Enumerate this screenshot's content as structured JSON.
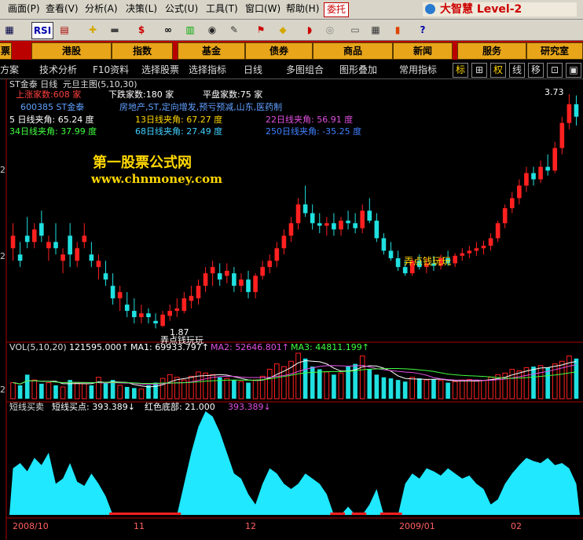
{
  "menu": [
    "画面(P)",
    "查看(V)",
    "分析(A)",
    "决策(L)",
    "公式(U)",
    "工具(T)",
    "窗口(W)",
    "帮助(H)"
  ],
  "entrust_label": "委托",
  "brand": "大智慧 Level-2",
  "toolbar_icons": [
    "grid-icon",
    "rsi-icon",
    "chart-icon",
    "cross-icon",
    "ruler-icon",
    "dollar-icon",
    "glasses-icon",
    "analysis-icon",
    "binoculars-icon",
    "tools-icon",
    "flag-icon",
    "diamond-icon",
    "lips-icon",
    "cd-icon",
    "print-icon",
    "table-icon",
    "bars-icon",
    "help-icon"
  ],
  "toolbar_text": {
    "rsi": "RSI",
    "dollar": "$"
  },
  "tabs": [
    "票",
    "港股",
    "指数",
    "基金",
    "债券",
    "商品",
    "新闻",
    "服务",
    "研究室"
  ],
  "subbar": [
    "方案",
    "技术分析",
    "F10资料",
    "选择股票",
    "选择指标",
    "日线",
    "多图组合",
    "图形叠加",
    "常用指标"
  ],
  "subbar_buttons": [
    "标",
    "⊞",
    "权",
    "线",
    "移",
    "⊡",
    "▣"
  ],
  "chart_header": {
    "title": "ST金泰 日线",
    "subtitle": "元旦主图(5,10,30)",
    "up_count": "上涨家数:608 家",
    "down_count": "下跌家数:180 家",
    "flat_count": "平盘家数:75 家",
    "stock_code": "600385 ST金泰",
    "tags": "房地产,ST,定向增发,预亏预减,山东,医药制",
    "angles": [
      {
        "label": "5 日线夹角: 65.24 度",
        "color": "#ffffff"
      },
      {
        "label": "13日线夹角: 67.27 度",
        "color": "#ffd700"
      },
      {
        "label": "22日线夹角: 56.91 度",
        "color": "#e050e0"
      },
      {
        "label": "34日线夹角: 37.99 度",
        "color": "#40ff40"
      },
      {
        "label": "68日线夹角: 27.49 度",
        "color": "#40d0ff"
      },
      {
        "label": "250日线夹角: -35.25 度",
        "color": "#4080ff"
      }
    ],
    "high_label": "3.73",
    "low_label": "1.87",
    "low_note": "弄点钱玩玩",
    "mid_note": "弄点钱玩玩"
  },
  "watermark": {
    "line1": "第一股票公式网",
    "line2": "www.chnmoney.com"
  },
  "volume_header": {
    "name": "VOL(5,10,20)",
    "vol": "121595.000↑",
    "ma1": "MA1: 69933.797↑",
    "ma2": "MA2: 52646.801↑",
    "ma3": "MA3: 44811.199↑"
  },
  "indicator_header": {
    "name": "短线买卖",
    "buy": "短线买点: 393.389↓",
    "red": "红色底部: 21.000",
    "val": "393.389↓"
  },
  "x_axis": [
    "2008/10",
    "11",
    "12",
    "2009/01",
    "02"
  ],
  "left_edge_ticks": [
    "2",
    "2",
    "2"
  ],
  "chart_data": [
    {
      "type": "candlestick",
      "title": "ST金泰 日线",
      "up_color": "#ff2020",
      "down_color": "#20e0e0",
      "candles": [
        [
          2.5,
          2.7,
          2.4,
          2.6
        ],
        [
          2.45,
          2.55,
          2.35,
          2.4
        ],
        [
          2.6,
          2.75,
          2.5,
          2.55
        ],
        [
          2.55,
          2.7,
          2.5,
          2.65
        ],
        [
          2.7,
          2.8,
          2.55,
          2.6
        ],
        [
          2.5,
          2.6,
          2.4,
          2.55
        ],
        [
          2.55,
          2.7,
          2.45,
          2.5
        ],
        [
          2.4,
          2.5,
          2.3,
          2.45
        ],
        [
          2.6,
          2.7,
          2.35,
          2.45
        ],
        [
          2.4,
          2.55,
          2.35,
          2.5
        ],
        [
          2.55,
          2.7,
          2.5,
          2.6
        ],
        [
          2.45,
          2.55,
          2.35,
          2.4
        ],
        [
          2.35,
          2.45,
          2.25,
          2.4
        ],
        [
          2.3,
          2.4,
          2.2,
          2.25
        ],
        [
          2.2,
          2.3,
          2.05,
          2.1
        ],
        [
          2.1,
          2.2,
          2.0,
          2.15
        ],
        [
          2.05,
          2.15,
          1.95,
          2.0
        ],
        [
          2.0,
          2.1,
          1.9,
          1.95
        ],
        [
          1.95,
          2.05,
          1.9,
          1.98
        ],
        [
          1.98,
          2.02,
          1.9,
          1.95
        ],
        [
          1.92,
          1.98,
          1.86,
          1.9
        ],
        [
          1.88,
          2.0,
          1.87,
          1.97
        ],
        [
          1.96,
          2.05,
          1.92,
          2.0
        ],
        [
          2.0,
          2.1,
          1.95,
          2.02
        ],
        [
          2.0,
          2.15,
          1.98,
          2.1
        ],
        [
          2.08,
          2.2,
          2.02,
          2.12
        ],
        [
          2.1,
          2.25,
          2.05,
          2.2
        ],
        [
          2.2,
          2.35,
          2.15,
          2.3
        ],
        [
          2.3,
          2.4,
          2.2,
          2.35
        ],
        [
          2.3,
          2.38,
          2.2,
          2.25
        ],
        [
          2.28,
          2.38,
          2.22,
          2.32
        ],
        [
          2.3,
          2.35,
          2.15,
          2.2
        ],
        [
          2.2,
          2.3,
          2.15,
          2.25
        ],
        [
          2.25,
          2.32,
          2.1,
          2.15
        ],
        [
          2.15,
          2.3,
          2.1,
          2.28
        ],
        [
          2.28,
          2.4,
          2.25,
          2.35
        ],
        [
          2.35,
          2.45,
          2.3,
          2.4
        ],
        [
          2.4,
          2.55,
          2.35,
          2.5
        ],
        [
          2.5,
          2.65,
          2.45,
          2.6
        ],
        [
          2.6,
          2.75,
          2.55,
          2.7
        ],
        [
          2.7,
          2.9,
          2.65,
          2.85
        ],
        [
          2.85,
          3.0,
          2.75,
          2.78
        ],
        [
          2.78,
          2.85,
          2.65,
          2.7
        ],
        [
          2.7,
          2.78,
          2.62,
          2.68
        ],
        [
          2.68,
          2.75,
          2.6,
          2.7
        ],
        [
          2.7,
          2.78,
          2.6,
          2.65
        ],
        [
          2.65,
          2.75,
          2.6,
          2.72
        ],
        [
          2.72,
          2.8,
          2.65,
          2.7
        ],
        [
          2.7,
          2.78,
          2.62,
          2.66
        ],
        [
          2.66,
          2.85,
          2.62,
          2.8
        ],
        [
          2.8,
          2.9,
          2.7,
          2.72
        ],
        [
          2.72,
          2.78,
          2.55,
          2.58
        ],
        [
          2.58,
          2.62,
          2.45,
          2.48
        ],
        [
          2.48,
          2.55,
          2.4,
          2.42
        ],
        [
          2.42,
          2.48,
          2.32,
          2.35
        ],
        [
          2.35,
          2.4,
          2.28,
          2.3
        ],
        [
          2.3,
          2.42,
          2.28,
          2.4
        ],
        [
          2.4,
          2.45,
          2.33,
          2.35
        ],
        [
          2.35,
          2.42,
          2.3,
          2.38
        ],
        [
          2.38,
          2.44,
          2.32,
          2.36
        ],
        [
          2.36,
          2.45,
          2.33,
          2.42
        ],
        [
          2.42,
          2.48,
          2.36,
          2.38
        ],
        [
          2.38,
          2.46,
          2.35,
          2.44
        ],
        [
          2.44,
          2.5,
          2.4,
          2.46
        ],
        [
          2.46,
          2.52,
          2.42,
          2.48
        ],
        [
          2.48,
          2.55,
          2.44,
          2.5
        ],
        [
          2.5,
          2.56,
          2.45,
          2.52
        ],
        [
          2.52,
          2.62,
          2.48,
          2.58
        ],
        [
          2.58,
          2.72,
          2.55,
          2.7
        ],
        [
          2.7,
          2.85,
          2.66,
          2.82
        ],
        [
          2.82,
          2.95,
          2.78,
          2.9
        ],
        [
          2.9,
          3.05,
          2.85,
          3.0
        ],
        [
          3.0,
          3.15,
          2.95,
          3.1
        ],
        [
          3.1,
          3.15,
          3.0,
          3.05
        ],
        [
          3.05,
          3.2,
          3.02,
          3.15
        ],
        [
          3.15,
          3.25,
          3.08,
          3.12
        ],
        [
          3.12,
          3.35,
          3.1,
          3.3
        ],
        [
          3.3,
          3.55,
          3.25,
          3.5
        ],
        [
          3.5,
          3.73,
          3.45,
          3.65
        ],
        [
          3.65,
          3.72,
          3.48,
          3.55
        ]
      ],
      "ylim": [
        1.85,
        3.78
      ]
    },
    {
      "type": "bar",
      "title": "VOL(5,10,20)",
      "volumes": [
        30,
        25,
        45,
        35,
        28,
        30,
        25,
        22,
        35,
        30,
        28,
        25,
        40,
        30,
        35,
        25,
        22,
        20,
        18,
        25,
        30,
        38,
        45,
        40,
        35,
        42,
        50,
        48,
        45,
        40,
        38,
        35,
        32,
        30,
        35,
        42,
        55,
        65,
        60,
        70,
        85,
        75,
        60,
        55,
        50,
        45,
        48,
        60,
        65,
        80,
        55,
        45,
        40,
        38,
        35,
        32,
        40,
        38,
        35,
        36,
        34,
        30,
        32,
        35,
        36,
        33,
        34,
        40,
        45,
        48,
        55,
        52,
        58,
        60,
        62,
        58,
        65,
        70,
        80,
        75
      ],
      "ma_series": [
        {
          "name": "MA1",
          "color": "#ffffff"
        },
        {
          "name": "MA2",
          "color": "#e050e0"
        },
        {
          "name": "MA3",
          "color": "#40ff40"
        }
      ]
    },
    {
      "type": "area",
      "title": "短线买卖",
      "values": [
        45,
        50,
        42,
        55,
        48,
        60,
        30,
        35,
        50,
        32,
        28,
        40,
        30,
        18,
        0,
        0,
        0,
        0,
        0,
        0,
        0,
        0,
        0,
        0,
        30,
        60,
        85,
        100,
        95,
        80,
        60,
        40,
        35,
        20,
        10,
        30,
        45,
        40,
        30,
        25,
        30,
        40,
        35,
        30,
        20,
        0,
        0,
        8,
        0,
        0,
        10,
        25,
        0,
        0,
        0,
        30,
        40,
        35,
        45,
        42,
        38,
        45,
        40,
        35,
        38,
        30,
        25,
        10,
        15,
        30,
        40,
        48,
        55,
        52,
        50,
        55,
        48,
        50,
        45,
        30
      ],
      "ylim": [
        0,
        100
      ]
    }
  ]
}
